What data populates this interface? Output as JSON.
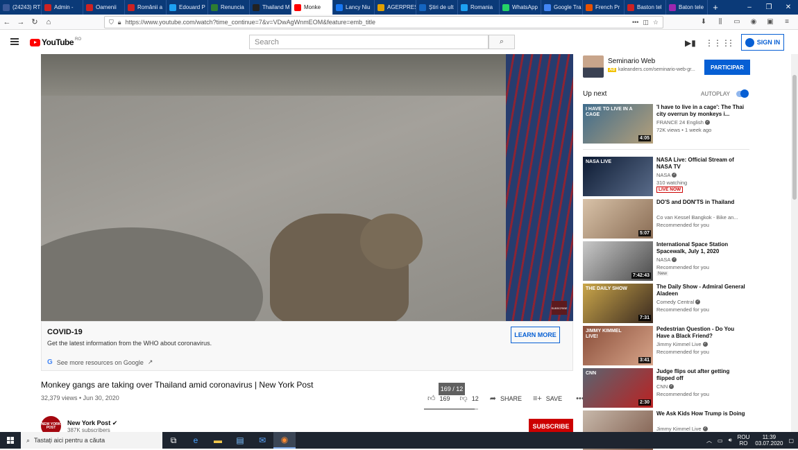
{
  "browser": {
    "tabs": [
      {
        "label": "(24243) RT",
        "color": "#3b5998"
      },
      {
        "label": "Admin -",
        "color": "#cc2222"
      },
      {
        "label": "Oamenii",
        "color": "#cc2222"
      },
      {
        "label": "Românii a",
        "color": "#cc2222"
      },
      {
        "label": "Edouard P",
        "color": "#1da1f2"
      },
      {
        "label": "Renuncia",
        "color": "#2e7d32"
      },
      {
        "label": "Thailand M",
        "color": "#222222"
      },
      {
        "label": "Monke",
        "color": "#ff0000"
      },
      {
        "label": "Lancy Niu",
        "color": "#1877f2"
      },
      {
        "label": "AGERPRES",
        "color": "#e0a000"
      },
      {
        "label": "Știri de ult",
        "color": "#1565c0"
      },
      {
        "label": "Romania",
        "color": "#1da1f2"
      },
      {
        "label": "WhatsApp",
        "color": "#25d366"
      },
      {
        "label": "Google Tra",
        "color": "#4285f4"
      },
      {
        "label": "French Pr",
        "color": "#e65100"
      },
      {
        "label": "Baston tel",
        "color": "#cc2222"
      },
      {
        "label": "Baton tele",
        "color": "#9c27b0"
      }
    ],
    "active_tab": 7,
    "url": "https://www.youtube.com/watch?time_continue=7&v=VDwAgWnmEOM&feature=emb_title"
  },
  "youtube": {
    "logo_text": "YouTube",
    "region": "RO",
    "search_placeholder": "Search",
    "sign_in": "SIGN IN"
  },
  "player": {
    "watermark": "SUBSCRIBE"
  },
  "covid": {
    "title": "COVID-19",
    "description": "Get the latest information from the WHO about coronavirus.",
    "learn_more": "LEARN MORE",
    "more_resources": "See more resources on Google"
  },
  "video": {
    "title": "Monkey gangs are taking over Thailand amid coronavirus | New York Post",
    "meta": "32,379 views • Jun 30, 2020",
    "tooltip": "169 / 12",
    "likes": "169",
    "dislikes": "12",
    "sentiment_like_fraction": 0.934,
    "share": "SHARE",
    "save": "SAVE",
    "channel": "New York Post",
    "channel_logo": "NEW YORK POST",
    "subscribers": "387K subscribers",
    "subscribe": "SUBSCRIBE"
  },
  "ad": {
    "name": "Seminario Web",
    "badge": "Ad",
    "url": "kaleanders.com/seminario-web-gr...",
    "cta": "PARTICIPAR"
  },
  "sidebar": {
    "up_next": "Up next",
    "autoplay": "AUTOPLAY",
    "autoplay_on": true,
    "recs": [
      {
        "title": "'I have to live in a cage': The Thai city overrun by monkeys i...",
        "channel": "FRANCE 24 English",
        "meta": "72K views • 1 week ago",
        "duration": "4:05",
        "tag": "",
        "thumb_text": "I HAVE TO LIVE IN A CAGE"
      },
      {
        "title": "NASA Live: Official Stream of NASA TV",
        "channel": "NASA",
        "meta": "310 watching",
        "duration": "",
        "tag": "LIVE NOW",
        "thumb_text": "NASA LIVE"
      },
      {
        "title": "DO'S and DON'TS in Thailand",
        "channel": "Co van Kessel Bangkok - Bike an...",
        "meta": "Recommended for you",
        "duration": "5:07",
        "tag": "",
        "thumb_text": ""
      },
      {
        "title": "International Space Station Spacewalk, July 1, 2020",
        "channel": "NASA",
        "meta": "Recommended for you",
        "duration": "7:42:43",
        "tag": "New",
        "thumb_text": ""
      },
      {
        "title": "The Daily Show - Admiral General Aladeen",
        "channel": "Comedy Central",
        "meta": "Recommended for you",
        "duration": "7:31",
        "tag": "",
        "thumb_text": "THE DAILY SHOW"
      },
      {
        "title": "Pedestrian Question - Do You Have a Black Friend?",
        "channel": "Jimmy Kimmel Live",
        "meta": "Recommended for you",
        "duration": "3:41",
        "tag": "",
        "thumb_text": "JIMMY KIMMEL LIVE!"
      },
      {
        "title": "Judge flips out after getting flipped off",
        "channel": "CNN",
        "meta": "Recommended for you",
        "duration": "2:30",
        "tag": "",
        "thumb_text": "CNN"
      },
      {
        "title": "We Ask Kids How Trump is Doing",
        "channel": "Jimmy Kimmel Live",
        "meta": "",
        "duration": "",
        "tag": "",
        "thumb_text": ""
      }
    ]
  },
  "taskbar": {
    "search_placeholder": "Tastați aici pentru a căuta",
    "lang_top": "ROU",
    "lang_bottom": "RO",
    "time": "11:39",
    "date": "03.07.2020"
  }
}
